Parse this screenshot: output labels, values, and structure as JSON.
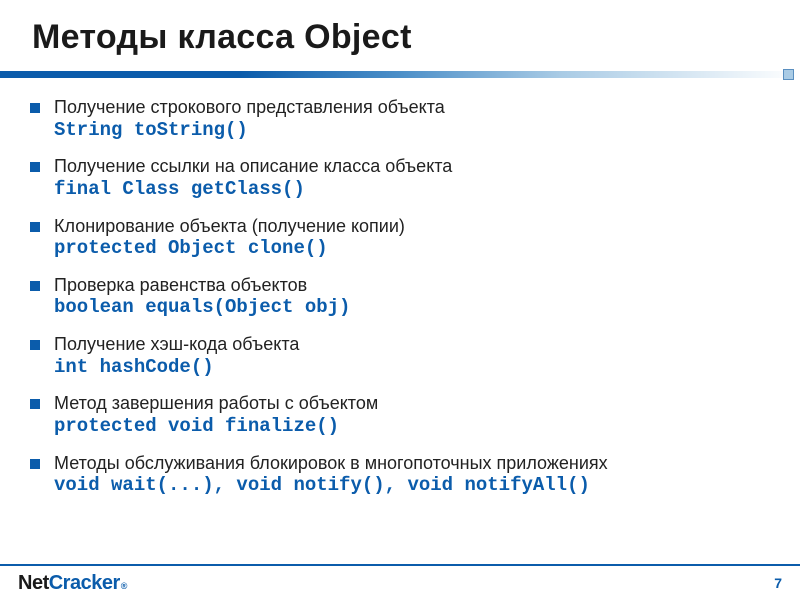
{
  "title": "Методы класса Object",
  "bullets": [
    {
      "desc": "Получение строкового представления объекта",
      "code": "String toString()"
    },
    {
      "desc": "Получение ссылки на описание класса объекта",
      "code": "final Class getClass()"
    },
    {
      "desc": "Клонирование объекта (получение копии)",
      "code": "protected Object clone()"
    },
    {
      "desc": "Проверка равенства объектов",
      "code": "boolean equals(Object obj)"
    },
    {
      "desc": "Получение хэш-кода объекта",
      "code": "int hashCode()"
    },
    {
      "desc": "Метод завершения работы с объектом",
      "code": "protected void finalize()"
    },
    {
      "desc": "Методы обслуживания блокировок в многопоточных приложениях",
      "code": "void wait(...), void notify(), void notifyAll()"
    }
  ],
  "logo": {
    "part1": "Net",
    "part2": "Cracker",
    "reg": "®"
  },
  "page_number": "7"
}
